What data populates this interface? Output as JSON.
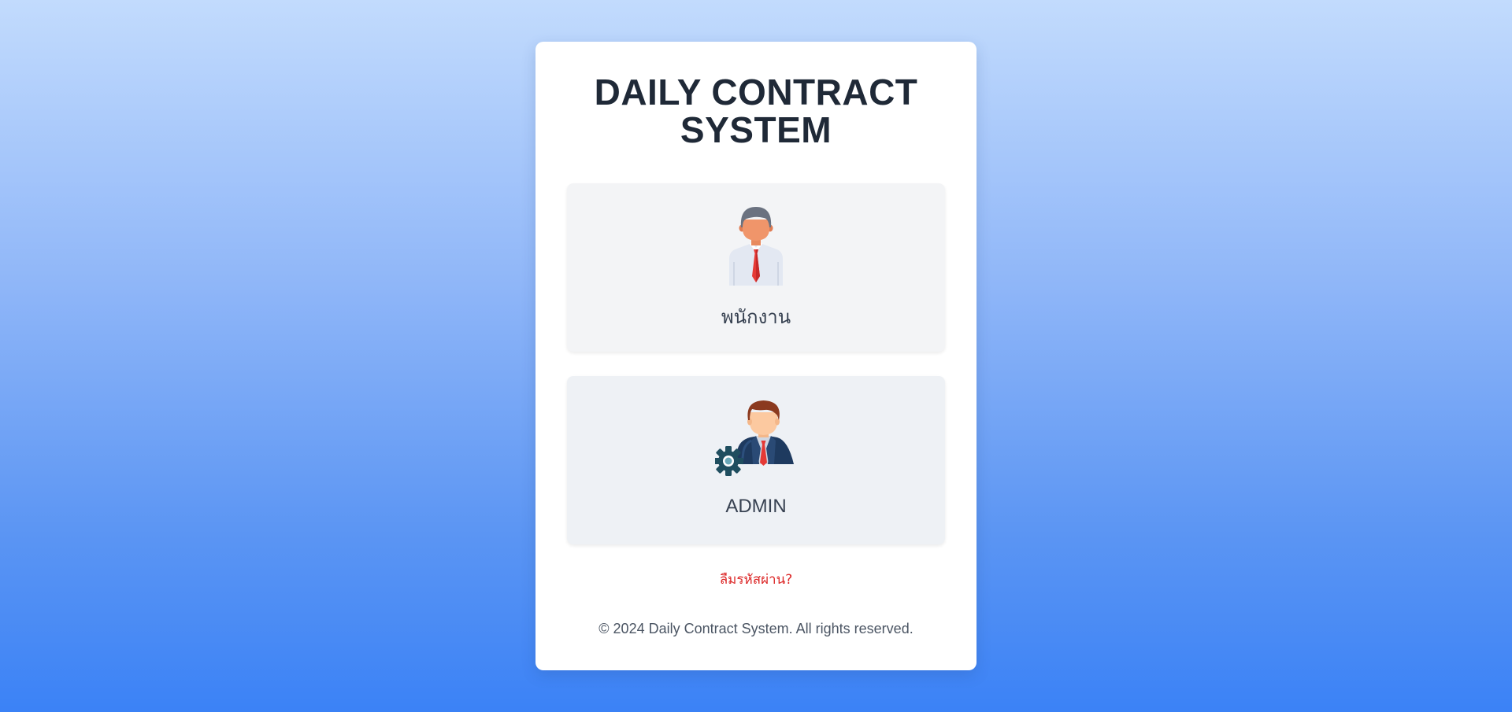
{
  "app": {
    "title": "DAILY CONTRACT SYSTEM"
  },
  "roles": [
    {
      "label": "พนักงาน",
      "icon": "employee-icon"
    },
    {
      "label": "ADMIN",
      "icon": "admin-icon"
    }
  ],
  "links": {
    "forgot_password": "ลืมรหัสผ่าน?"
  },
  "footer": {
    "text": "© 2024 Daily Contract System. All rights reserved."
  },
  "colors": {
    "background_top": "#c2dbfd",
    "background_bottom": "#3b82f6",
    "title": "#1f2937",
    "card": "#ffffff",
    "role_card": "#f3f4f6",
    "link": "#dc2626",
    "footer": "#4b5563"
  }
}
